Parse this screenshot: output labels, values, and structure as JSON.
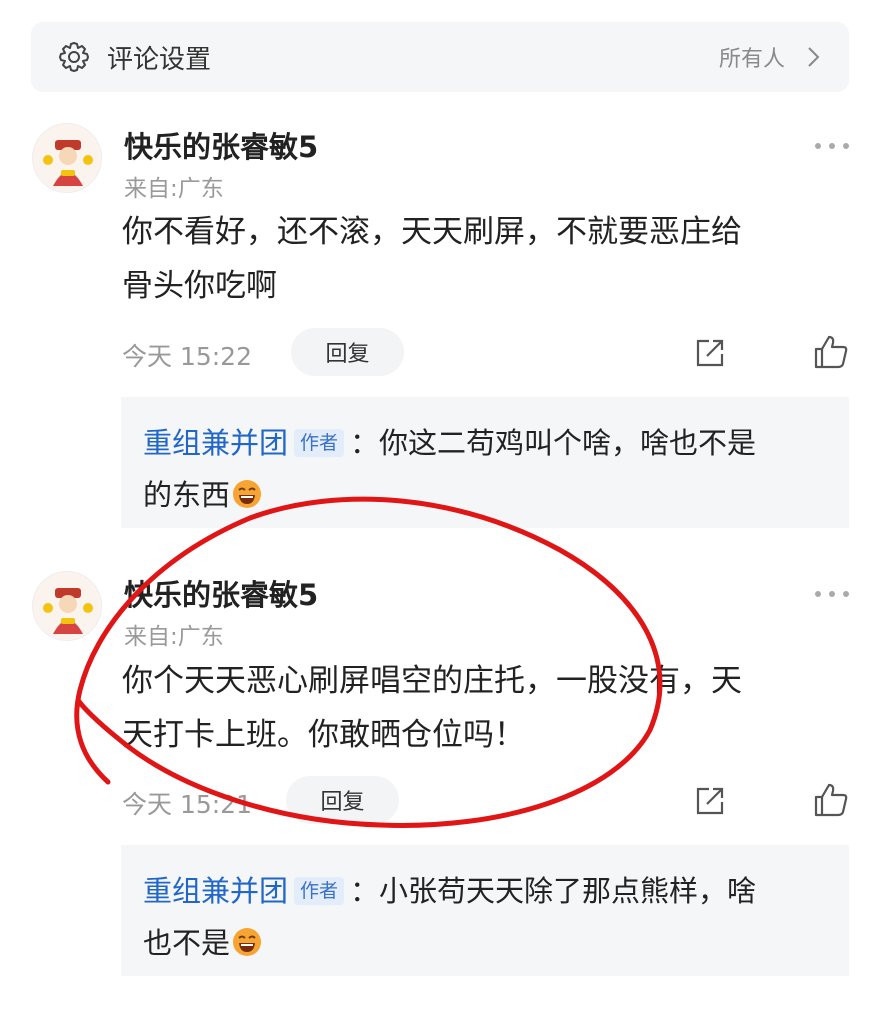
{
  "settings": {
    "title": "评论设置",
    "value": "所有人"
  },
  "comments": [
    {
      "username": "快乐的张睿敏5",
      "location": "来自:广东",
      "text_line1": "你不看好，还不滚，天天刷屏，不就要恶庄给",
      "text_line2": "骨头你吃啊",
      "time": "今天 15:22",
      "reply_label": "回复",
      "reply": {
        "author": "重组兼并团",
        "tag": "作者",
        "separator": "：",
        "text_line1": "你这二苟鸡叫个啥，啥也不是",
        "text_line2": "的东西"
      }
    },
    {
      "username": "快乐的张睿敏5",
      "location": "来自:广东",
      "text_line1": "你个天天恶心刷屏唱空的庄托，一股没有，天",
      "text_line2": "天打卡上班。你敢晒仓位吗！",
      "time": "今天 15:21",
      "reply_label": "回复",
      "reply": {
        "author": "重组兼并团",
        "tag": "作者",
        "separator": "：",
        "text_line1": "小张苟天天除了那点熊样，啥",
        "text_line2": "也不是"
      }
    }
  ],
  "colors": {
    "link_blue": "#2166c9",
    "annotation_red": "#e01515",
    "reply_bg": "#f5f6f7"
  },
  "icons": [
    "gear-icon",
    "chevron-right-icon",
    "more-icon",
    "share-icon",
    "thumbs-up-icon",
    "laughing-emoji-icon"
  ]
}
